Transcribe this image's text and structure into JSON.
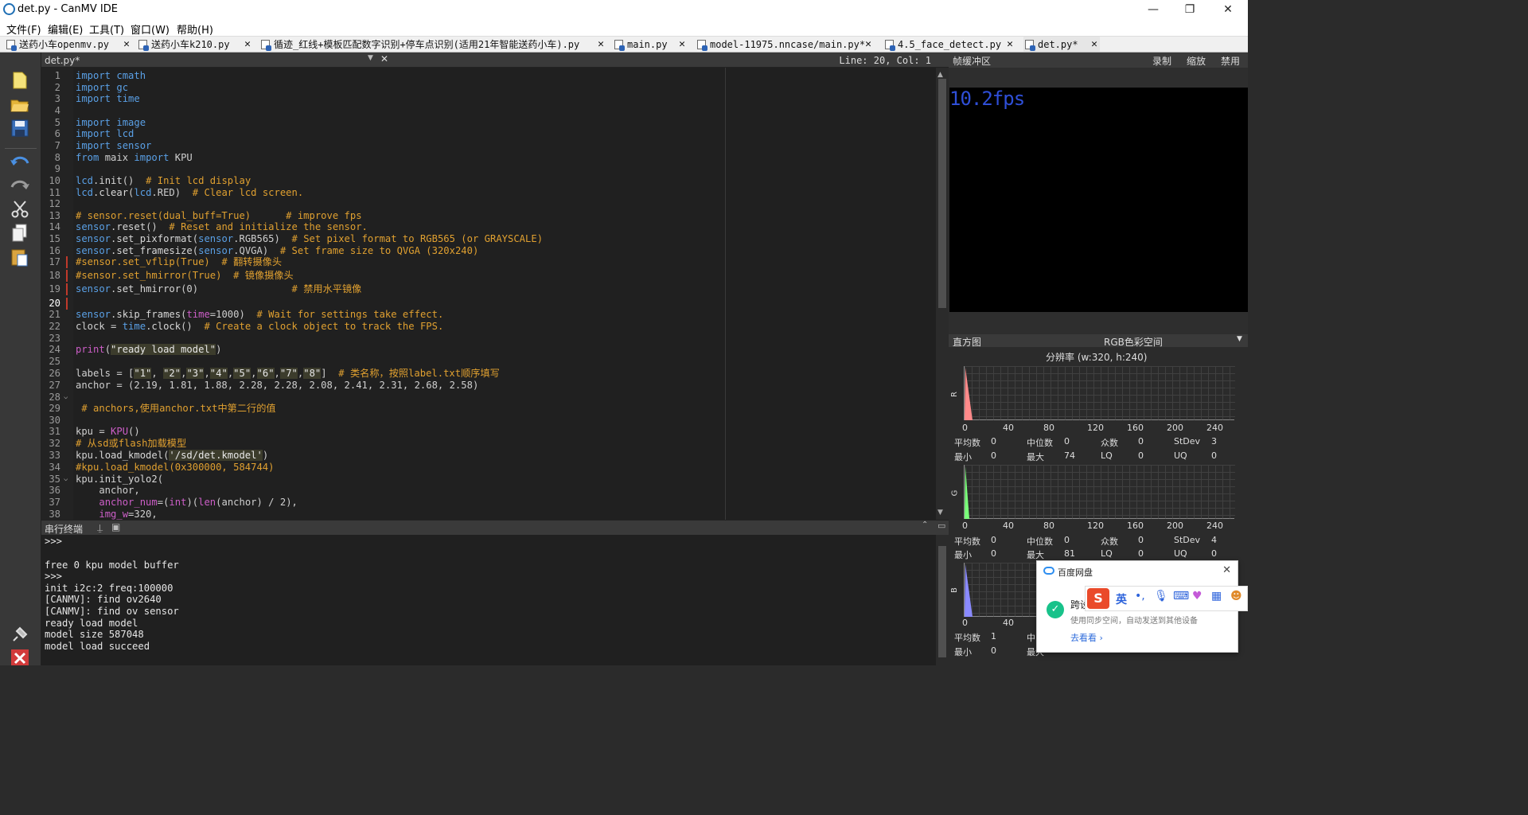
{
  "window": {
    "title": "det.py - CanMV IDE"
  },
  "menu": [
    "文件(F)",
    "编辑(E)",
    "工具(T)",
    "窗口(W)",
    "帮助(H)"
  ],
  "tabs": [
    {
      "label": "送药小车openmv.py"
    },
    {
      "label": "送药小车k210.py"
    },
    {
      "label": "循迹_红线+模板匹配数字识别+停车点识别(适用21年智能送药小车).py"
    },
    {
      "label": "main.py"
    },
    {
      "label": "model-11975.nncase/main.py*"
    },
    {
      "label": "4.5_face_detect.py"
    },
    {
      "label": "det.py*"
    }
  ],
  "editor": {
    "file": "det.py*",
    "cursor": "Line: 20, Col: 1",
    "lines": [
      [
        [
          "kw",
          "import"
        ],
        [
          "c",
          " "
        ],
        [
          "kw",
          "cmath"
        ]
      ],
      [
        [
          "kw",
          "import"
        ],
        [
          "c",
          " "
        ],
        [
          "kw",
          "gc"
        ]
      ],
      [
        [
          "kw",
          "import"
        ],
        [
          "c",
          " "
        ],
        [
          "kw",
          "time"
        ]
      ],
      [],
      [
        [
          "kw",
          "import"
        ],
        [
          "c",
          " "
        ],
        [
          "kw",
          "image"
        ]
      ],
      [
        [
          "kw",
          "import"
        ],
        [
          "c",
          " "
        ],
        [
          "kw",
          "lcd"
        ]
      ],
      [
        [
          "kw",
          "import"
        ],
        [
          "c",
          " "
        ],
        [
          "kw",
          "sensor"
        ]
      ],
      [
        [
          "kw",
          "from"
        ],
        [
          "c",
          " maix "
        ],
        [
          "kw",
          "import"
        ],
        [
          "c",
          " KPU"
        ]
      ],
      [],
      [
        [
          "kw",
          "lcd"
        ],
        [
          "c",
          "."
        ],
        [
          "fn",
          "init"
        ],
        [
          "c",
          "()  "
        ],
        [
          "cm",
          "# Init lcd display"
        ]
      ],
      [
        [
          "kw",
          "lcd"
        ],
        [
          "c",
          "."
        ],
        [
          "fn",
          "clear"
        ],
        [
          "c",
          "("
        ],
        [
          "kw",
          "lcd"
        ],
        [
          "c",
          ".RED)  "
        ],
        [
          "cm",
          "# Clear lcd screen."
        ]
      ],
      [],
      [
        [
          "cm",
          "# sensor.reset(dual_buff=True)      # improve fps"
        ]
      ],
      [
        [
          "kw",
          "sensor"
        ],
        [
          "c",
          "."
        ],
        [
          "fn",
          "reset"
        ],
        [
          "c",
          "()  "
        ],
        [
          "cm",
          "# Reset and initialize the sensor."
        ]
      ],
      [
        [
          "kw",
          "sensor"
        ],
        [
          "c",
          "."
        ],
        [
          "fn",
          "set_pixformat"
        ],
        [
          "c",
          "("
        ],
        [
          "kw",
          "sensor"
        ],
        [
          "c",
          ".RGB565)  "
        ],
        [
          "cm",
          "# Set pixel format to RGB565 (or GRAYSCALE)"
        ]
      ],
      [
        [
          "kw",
          "sensor"
        ],
        [
          "c",
          "."
        ],
        [
          "fn",
          "set_framesize"
        ],
        [
          "c",
          "("
        ],
        [
          "kw",
          "sensor"
        ],
        [
          "c",
          ".QVGA)  "
        ],
        [
          "cm",
          "# Set frame size to QVGA (320x240)"
        ]
      ],
      [
        [
          "cm",
          "#sensor.set_vflip(True)  # 翻转摄像头"
        ]
      ],
      [
        [
          "cm",
          "#sensor.set_hmirror(True)  # 镜像摄像头"
        ]
      ],
      [
        [
          "kw",
          "sensor"
        ],
        [
          "c",
          "."
        ],
        [
          "fn",
          "set_hmirror"
        ],
        [
          "c",
          "(0)                "
        ],
        [
          "cm",
          "# 禁用水平镜像"
        ]
      ],
      [],
      [
        [
          "kw",
          "sensor"
        ],
        [
          "c",
          "."
        ],
        [
          "fn",
          "skip_frames"
        ],
        [
          "c",
          "("
        ],
        [
          "ob",
          "time"
        ],
        [
          "c",
          "=1000)  "
        ],
        [
          "cm",
          "# Wait for settings take effect."
        ]
      ],
      [
        [
          "c",
          "clock = "
        ],
        [
          "kw",
          "time"
        ],
        [
          "c",
          "."
        ],
        [
          "fn",
          "clock"
        ],
        [
          "c",
          "()  "
        ],
        [
          "cm",
          "# Create a clock object to track the FPS."
        ]
      ],
      [],
      [
        [
          "ob",
          "print"
        ],
        [
          "c",
          "("
        ],
        [
          "st",
          "\"ready load model\""
        ],
        [
          "c",
          ")"
        ]
      ],
      [],
      [
        [
          "c",
          "labels = ["
        ],
        [
          "st",
          "\"1\""
        ],
        [
          "c",
          ", "
        ],
        [
          "st",
          "\"2\""
        ],
        [
          "c",
          ","
        ],
        [
          "st",
          "\"3\""
        ],
        [
          "c",
          ","
        ],
        [
          "st",
          "\"4\""
        ],
        [
          "c",
          ","
        ],
        [
          "st",
          "\"5\""
        ],
        [
          "c",
          ","
        ],
        [
          "st",
          "\"6\""
        ],
        [
          "c",
          ","
        ],
        [
          "st",
          "\"7\""
        ],
        [
          "c",
          ","
        ],
        [
          "st",
          "\"8\""
        ],
        [
          "c",
          "]  "
        ],
        [
          "cm",
          "# 类名称，按照label.txt顺序填写"
        ]
      ],
      [
        [
          "c",
          "anchor = (2.19, 1.81, 1.88, 2.28, 2.28, 2.08, 2.41, 2.31, 2.68, 2.58)"
        ]
      ],
      [],
      [
        [
          "cm",
          " # anchors,使用anchor.txt中第二行的值"
        ]
      ],
      [],
      [
        [
          "c",
          "kpu = "
        ],
        [
          "ob",
          "KPU"
        ],
        [
          "c",
          "()"
        ]
      ],
      [
        [
          "cm",
          "# 从sd或flash加载模型"
        ]
      ],
      [
        [
          "c",
          "kpu."
        ],
        [
          "fn",
          "load_kmodel"
        ],
        [
          "c",
          "("
        ],
        [
          "st",
          "'/sd/det.kmodel'"
        ],
        [
          "c",
          ")"
        ]
      ],
      [
        [
          "cm",
          "#kpu.load_kmodel(0x300000, 584744)"
        ]
      ],
      [
        [
          "c",
          "kpu."
        ],
        [
          "fn",
          "init_yolo2"
        ],
        [
          "c",
          "("
        ]
      ],
      [
        [
          "c",
          "    anchor,"
        ]
      ],
      [
        [
          "c",
          "    "
        ],
        [
          "ob",
          "anchor_num"
        ],
        [
          "c",
          "=("
        ],
        [
          "ob",
          "int"
        ],
        [
          "c",
          ")("
        ],
        [
          "ob",
          "len"
        ],
        [
          "c",
          "(anchor) / 2),"
        ]
      ],
      [
        [
          "c",
          "    "
        ],
        [
          "ob",
          "img_w"
        ],
        [
          "c",
          "=320,"
        ]
      ]
    ]
  },
  "serial": {
    "title": "串行终端",
    "lines": [
      ">>>",
      "",
      "free 0 kpu model buffer",
      ">>>",
      "init i2c:2 freq:100000",
      "[CANMV]: find ov2640",
      "[CANMV]: find ov sensor",
      "ready load model",
      "model size 587048",
      "model load succeed"
    ]
  },
  "framebuffer": {
    "title": "帧缓冲区",
    "record": "录制",
    "zoom": "缩放",
    "disable": "禁用",
    "fps": "10.2fps"
  },
  "histogram": {
    "title": "直方图",
    "colorspace": "RGB色彩空间",
    "resolution": "分辨率 (w:320, h:240)",
    "ticks": [
      "0",
      "40",
      "80",
      "120",
      "160",
      "200",
      "240"
    ],
    "labels": {
      "mean": "平均数",
      "median": "中位数",
      "mode": "众数",
      "stdev": "StDev",
      "min": "最小",
      "max": "最大",
      "lq": "LQ",
      "uq": "UQ"
    },
    "channels": [
      {
        "name": "R",
        "color": "#ff8a8a",
        "mean": "0",
        "median": "0",
        "mode": "0",
        "stdev": "3",
        "min": "0",
        "max": "74",
        "lq": "0",
        "uq": "0"
      },
      {
        "name": "G",
        "color": "#7aff7a",
        "mean": "0",
        "median": "0",
        "mode": "0",
        "stdev": "4",
        "min": "0",
        "max": "81",
        "lq": "0",
        "uq": "0"
      },
      {
        "name": "B",
        "color": "#8a8aff",
        "mean": "1",
        "median": "中",
        "min": "0",
        "max": "最大"
      }
    ]
  },
  "popup": {
    "title": "百度网盘",
    "main": "跨设",
    "sub": "使用同步空间，自动发送到其他设备",
    "link": "去看看 ›"
  },
  "ime": {
    "lang": "英"
  }
}
